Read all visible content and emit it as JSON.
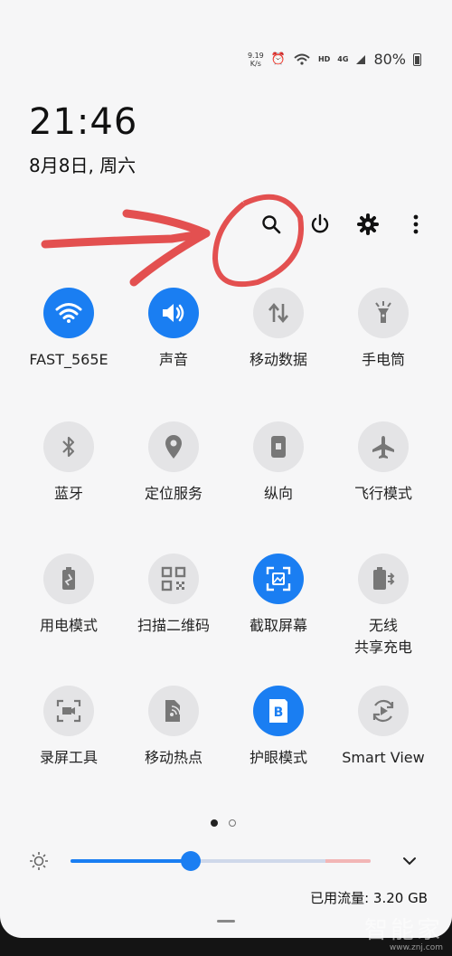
{
  "status_bar": {
    "net_speed_value": "9.19",
    "net_speed_unit": "K/s",
    "hd_label": "HD",
    "network_label": "4G",
    "battery_percent": "80%",
    "icons": [
      "alarm-icon",
      "wifi-calling-icon",
      "hd-icon",
      "signal-icon",
      "battery-icon"
    ]
  },
  "clock": {
    "time": "21:46",
    "date": "8月8日, 周六"
  },
  "top_actions": [
    "search-icon",
    "power-icon",
    "settings-icon",
    "more-icon"
  ],
  "tiles": [
    {
      "label": "FAST_565E",
      "icon": "wifi-icon",
      "active": true
    },
    {
      "label": "声音",
      "icon": "volume-icon",
      "active": true
    },
    {
      "label": "移动数据",
      "icon": "mobile-data-icon",
      "active": false
    },
    {
      "label": "手电筒",
      "icon": "flashlight-icon",
      "active": false
    },
    {
      "label": "蓝牙",
      "icon": "bluetooth-icon",
      "active": false
    },
    {
      "label": "定位服务",
      "icon": "location-icon",
      "active": false
    },
    {
      "label": "纵向",
      "icon": "portrait-icon",
      "active": false
    },
    {
      "label": "飞行模式",
      "icon": "airplane-icon",
      "active": false
    },
    {
      "label": "用电模式",
      "icon": "power-mode-icon",
      "active": false
    },
    {
      "label": "扫描二维码",
      "icon": "qr-code-icon",
      "active": false
    },
    {
      "label": "截取屏幕",
      "icon": "screenshot-icon",
      "active": true
    },
    {
      "label": "无线\n共享充电",
      "icon": "wireless-share-icon",
      "active": false
    },
    {
      "label": "录屏工具",
      "icon": "screen-record-icon",
      "active": false
    },
    {
      "label": "移动热点",
      "icon": "hotspot-icon",
      "active": false
    },
    {
      "label": "护眼模式",
      "icon": "eye-comfort-icon",
      "active": true
    },
    {
      "label": "Smart View",
      "icon": "smart-view-icon",
      "active": false
    }
  ],
  "page_indicator": {
    "current": 1,
    "total": 2
  },
  "brightness": {
    "level": 0.4
  },
  "data_usage": "已用流量: 3.20 GB",
  "watermark": {
    "main": "智能家",
    "sub": "www.znj.com"
  },
  "colors": {
    "accent": "#1a7ef2",
    "tile_off": "#e4e4e6",
    "panel": "#f6f6f7",
    "annotation": "#e35050"
  }
}
